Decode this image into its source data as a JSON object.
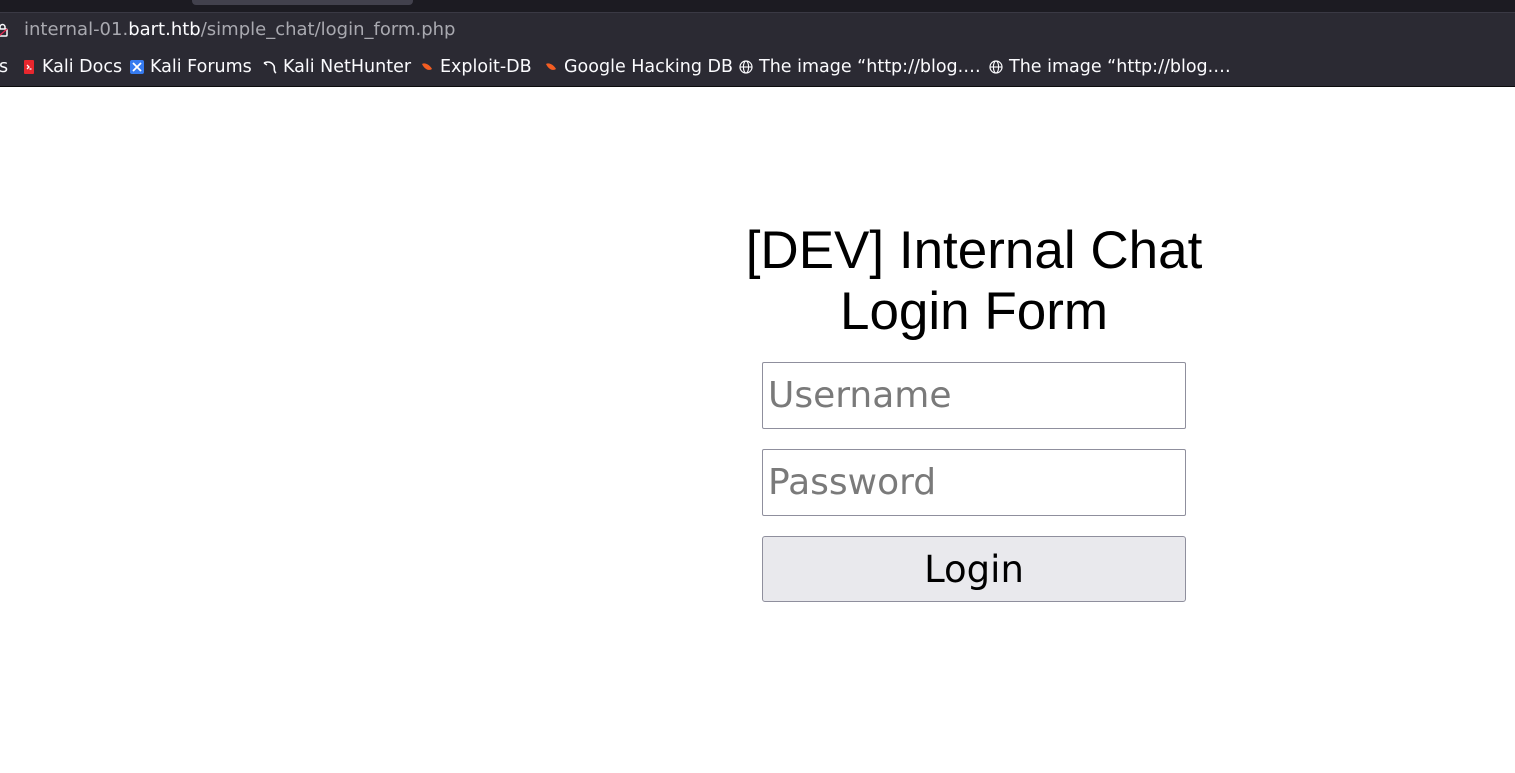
{
  "browser": {
    "url_prefix": "internal-01.",
    "url_host": "bart.htb",
    "url_path": "/simple_chat/login_form.php"
  },
  "bookmarks": [
    {
      "label": "s",
      "icon": "none"
    },
    {
      "label": "Kali Docs",
      "icon": "kali-docs-icon",
      "color": "#e8272e"
    },
    {
      "label": "Kali Forums",
      "icon": "kali-forums-icon",
      "color": "#367bf0"
    },
    {
      "label": "Kali NetHunter",
      "icon": "kali-dragon-icon",
      "color": "#000000"
    },
    {
      "label": "Exploit-DB",
      "icon": "exploit-db-icon",
      "color": "#f35d22"
    },
    {
      "label": "Google Hacking DB",
      "icon": "ghdb-icon",
      "color": "#f35d22"
    },
    {
      "label": "The image “http://blog.…",
      "icon": "globe-icon"
    },
    {
      "label": "The image “http://blog.…",
      "icon": "globe-icon"
    }
  ],
  "page": {
    "title_line1": "[DEV] Internal Chat",
    "title_line2": "Login Form",
    "username_placeholder": "Username",
    "password_placeholder": "Password",
    "login_label": "Login"
  }
}
